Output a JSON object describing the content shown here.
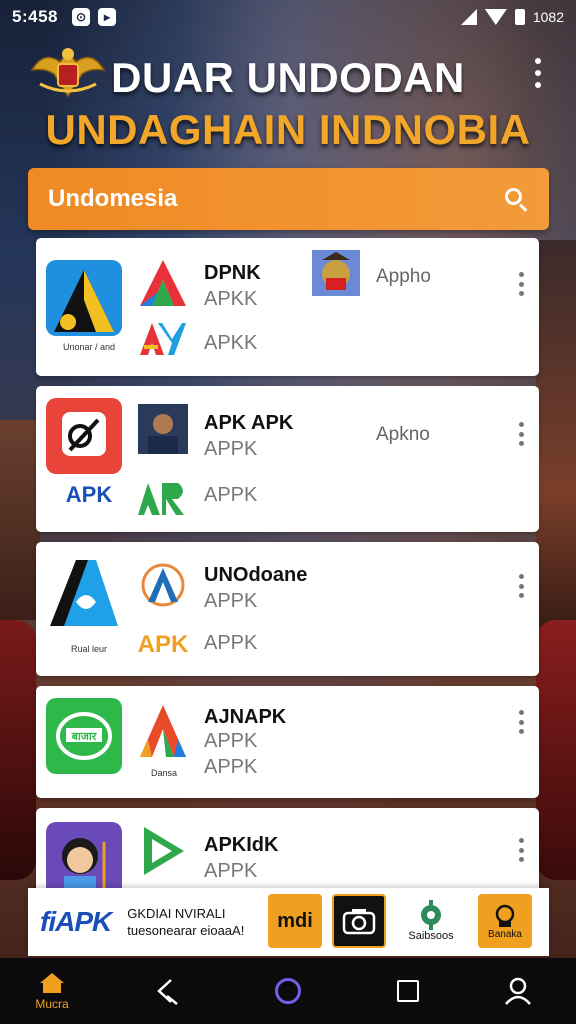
{
  "status_bar": {
    "time": "5:458",
    "icons": [
      "notification-icon",
      "app-icon"
    ],
    "battery_text": "1082"
  },
  "header": {
    "title": "DUAR UNDODAN",
    "subtitle": "UNDAGHAIN INDNOBIA"
  },
  "search": {
    "label": "Undomesia"
  },
  "apps": [
    {
      "main_caption": "Unonar / and",
      "name": "DPNK",
      "sub1": "APKK",
      "sub2": "APKK",
      "extra": "Appho",
      "main_color": "#1f8fe0",
      "small_color": "#e8323a"
    },
    {
      "main_caption": "APK",
      "name": "APK APK",
      "sub1": "APPK",
      "sub2": "APPK",
      "extra": "Apkno",
      "main_color": "#e8443a",
      "small_color": "#2e8a3a"
    },
    {
      "main_caption": "Rual leur",
      "name": "UNOdoane",
      "sub1": "APPK",
      "sub2": "APPK",
      "extra": "",
      "main_color": "#1fa0e8",
      "small_color": "#f0a020"
    },
    {
      "main_caption": "Dansa",
      "name": "AJNAPK",
      "sub1": "APPK",
      "sub2": "APPK",
      "extra": "",
      "main_color": "#2fb84a",
      "small_color": "#e84a2a"
    },
    {
      "main_caption": "",
      "name": "APKIdK",
      "sub1": "APPK",
      "sub2": "",
      "extra": "",
      "main_color": "#6a4ab8",
      "small_color": "#2ea84a"
    }
  ],
  "ad": {
    "logo": "fiAPK",
    "line1": "GKDIAI NVIRALI",
    "line2": "tuesonearar eioaaA!",
    "tile1_text": "mdi",
    "tile3_label": "Saibsoos",
    "tile4_label": "Banaka"
  },
  "nav": {
    "home_label": "Mucra"
  }
}
